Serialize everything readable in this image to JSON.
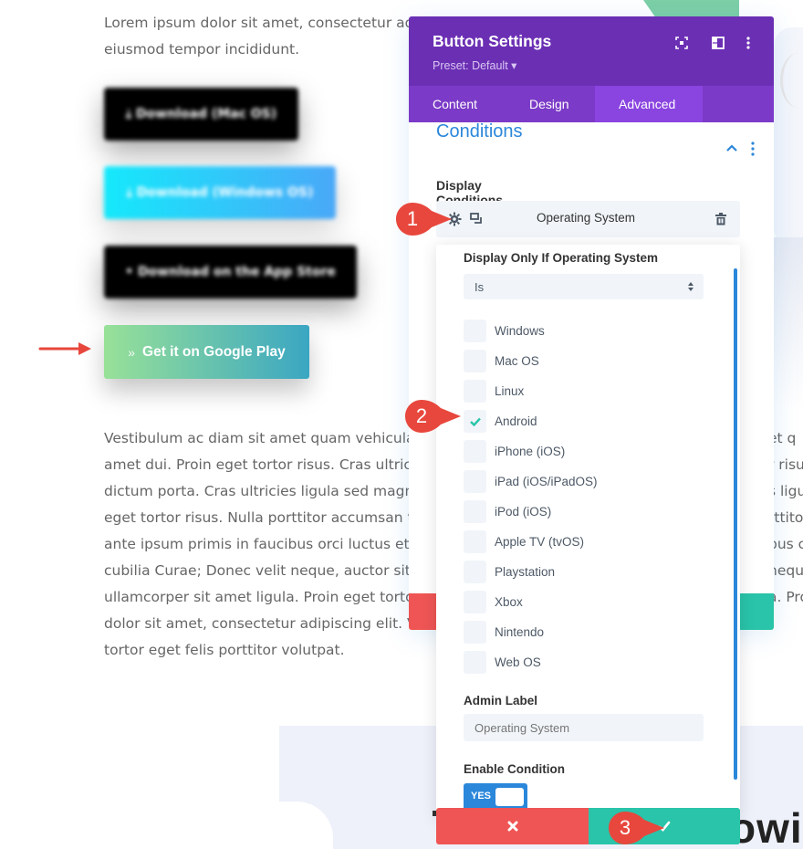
{
  "page": {
    "intro_lines": [
      "Lorem ipsum dolor sit amet, consectetur adip",
      "eiusmod tempor incididunt."
    ],
    "download_buttons": [
      {
        "label": "Download (Mac OS)",
        "icon": "download-icon",
        "blurred": true
      },
      {
        "label": "Download (Windows OS)",
        "icon": "download-icon",
        "blurred": true
      },
      {
        "label": "Download on the App Store",
        "icon": "apple-icon",
        "blurred": true
      }
    ],
    "google_play_button": {
      "icon": "»",
      "label": "Get it on Google Play"
    },
    "body_lines": [
      "Vestibulum ac diam sit amet quam vehicula e",
      "amet dui. Proin eget tortor risus. Cras ultricie",
      "dictum porta. Cras ultricies ligula sed magna",
      "eget tortor risus. Nulla porttitor accumsan tir",
      "ante ipsum primis in faucibus orci luctus et u",
      "cubilia Curae; Donec velit neque, auctor sit ar",
      "ullamcorper sit amet ligula. Proin eget tortor",
      "dolor sit amet, consectetur adipiscing elit. Viv",
      "tortor eget felis porttitor volutpat."
    ],
    "body_right_fragments": [
      "et q",
      "r risu",
      "s ligu",
      "rttito",
      "bus c",
      "nequ",
      "a. Pro"
    ],
    "heading_fragment": "owi"
  },
  "panel": {
    "title": "Button Settings",
    "preset": "Preset: Default ▾",
    "header_icons": [
      "fullscreen-icon",
      "split-view-icon",
      "more-vertical-icon"
    ],
    "tabs": [
      {
        "label": "Content",
        "active": false
      },
      {
        "label": "Design",
        "active": false
      },
      {
        "label": "Advanced",
        "active": true
      }
    ],
    "section_title": "Conditions",
    "display_conditions_label": "Display Conditions",
    "condition_row": {
      "label": "Operating System"
    }
  },
  "popup": {
    "rule_label": "Display Only If Operating System",
    "operator": "Is",
    "options": [
      {
        "label": "Windows",
        "checked": false
      },
      {
        "label": "Mac OS",
        "checked": false
      },
      {
        "label": "Linux",
        "checked": false
      },
      {
        "label": "Android",
        "checked": true
      },
      {
        "label": "iPhone (iOS)",
        "checked": false
      },
      {
        "label": "iPad (iOS/iPadOS)",
        "checked": false
      },
      {
        "label": "iPod (iOS)",
        "checked": false
      },
      {
        "label": "Apple TV (tvOS)",
        "checked": false
      },
      {
        "label": "Playstation",
        "checked": false
      },
      {
        "label": "Xbox",
        "checked": false
      },
      {
        "label": "Nintendo",
        "checked": false
      },
      {
        "label": "Web OS",
        "checked": false
      }
    ],
    "admin_label_title": "Admin Label",
    "admin_label_placeholder": "Operating System",
    "enable_condition_title": "Enable Condition",
    "enable_toggle": {
      "label": "YES",
      "on": true
    }
  },
  "markers": [
    {
      "number": "1"
    },
    {
      "number": "2"
    },
    {
      "number": "3"
    }
  ],
  "colors": {
    "header_purple": "#6b2fb4",
    "tab_purple": "#7b3ac7",
    "active_tab": "#8a44e0",
    "accent_blue": "#2b87da",
    "cancel_red": "#ef5555",
    "save_green": "#29c4a9",
    "marker_red": "#e8473d",
    "check_green": "#29c4a9"
  }
}
